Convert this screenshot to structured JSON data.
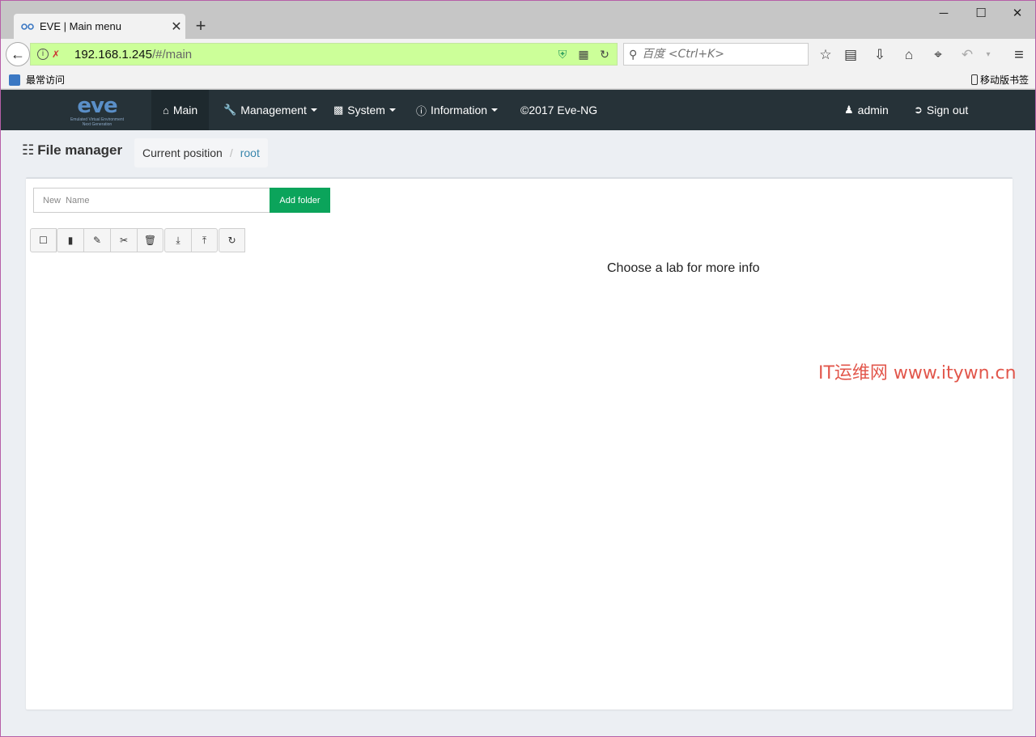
{
  "browser": {
    "tab_title": "EVE | Main menu",
    "tab_close": "✕",
    "new_tab": "+",
    "window_controls": {
      "minimize": "─",
      "maximize": "☐",
      "close": "✕"
    },
    "url_host": "192.168.1.245",
    "url_path": "/#/main",
    "search_placeholder": "百度 <Ctrl+K>",
    "bookmarks": {
      "left": "最常访问",
      "right": "移动版书签"
    }
  },
  "app": {
    "logo_text": "eve",
    "logo_subtitle_1": "Emulated Virtual Environment",
    "logo_subtitle_2": "Next Generation",
    "nav": {
      "main": "Main",
      "management": "Management",
      "system": "System",
      "information": "Information",
      "copyright": "©2017 Eve-NG",
      "user": "admin",
      "signout": "Sign out"
    },
    "page_title": "File manager",
    "breadcrumb": {
      "label": "Current position",
      "current": "root"
    },
    "new_name_placeholder": "New  Name",
    "add_folder": "Add folder",
    "info_message": "Choose a lab for more info"
  },
  "watermark": "IT运维网 www.itywn.cn",
  "colors": {
    "nav_bg": "#263238",
    "url_bg": "#ccff99",
    "add_folder": "#0ba45b",
    "breadcrumb_link": "#3a87ad"
  }
}
